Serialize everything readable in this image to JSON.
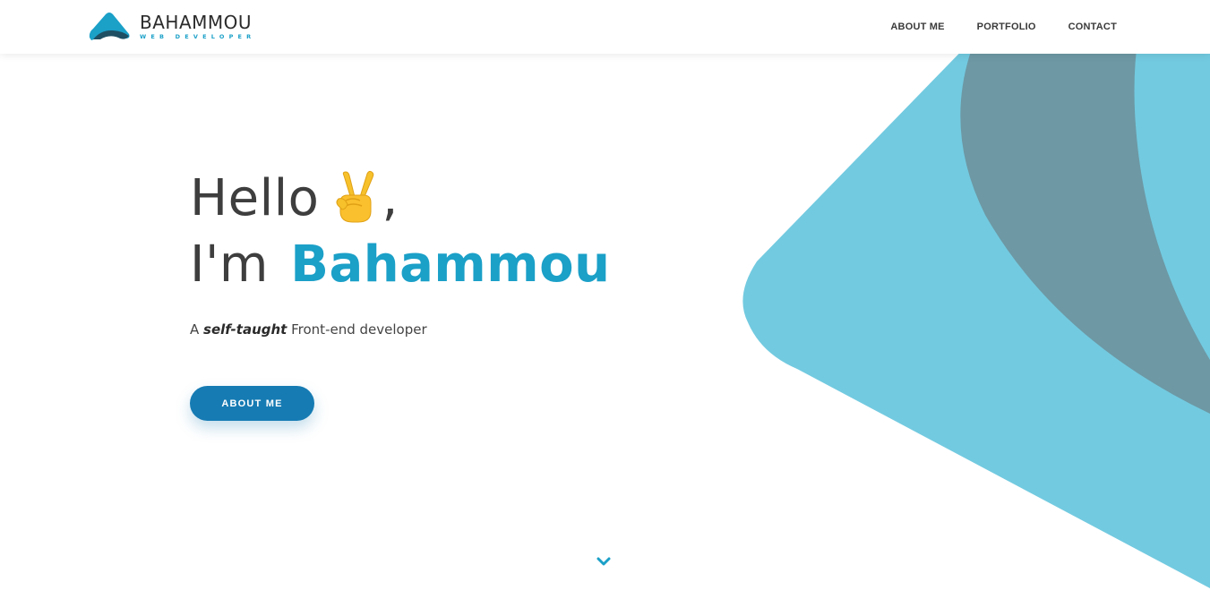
{
  "brand": {
    "name": "BAHAMMOU",
    "tagline": "WEB DEVELOPER",
    "accent_color": "#1ba0c8",
    "button_color": "#167bb3",
    "shape_light_color": "#72cae0",
    "shape_dark_color": "#6d98a4"
  },
  "nav": {
    "items": [
      {
        "label": "ABOUT ME"
      },
      {
        "label": "PORTFOLIO"
      },
      {
        "label": "CONTACT"
      }
    ]
  },
  "hero": {
    "greeting": "Hello",
    "greeting_emoji": "victory-hand-icon",
    "greeting_punct": ",",
    "intro_prefix": "I'm",
    "name": "Bahammou",
    "subtitle_prefix": "A",
    "subtitle_emphasis": "self-taught",
    "subtitle_suffix": "Front-end developer",
    "cta_label": "ABOUT ME"
  },
  "scroll_indicator": {
    "icon": "chevron-down-icon"
  }
}
